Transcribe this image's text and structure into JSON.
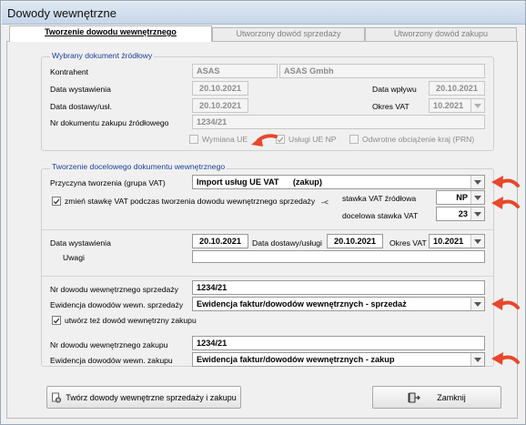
{
  "window": {
    "title": "Dowody wewnętrzne"
  },
  "tabs": [
    {
      "label": "Tworzenie  dowodu wewnętrznego"
    },
    {
      "label": "Utworzony dowód sprzedaży"
    },
    {
      "label": "Utworzony dowód zakupu"
    }
  ],
  "source_doc": {
    "legend": "Wybrany dokument źródłowy",
    "contractor_label": "Kontrahent",
    "contractor_code": "ASAS",
    "contractor_name": "ASAS Gmbh",
    "issue_date_label": "Data wystawienia",
    "issue_date": "20.10.2021",
    "receipt_date_label": "Data wpływu",
    "receipt_date": "20.10.2021",
    "delivery_date_label": "Data dostawy/usł.",
    "delivery_date": "20.10.2021",
    "vat_period_label": "Okres VAT",
    "vat_period": "10.2021",
    "doc_number_label": "Nr dokumentu  zakupu źródłowego",
    "doc_number": "1234/21",
    "checkboxes": [
      {
        "label": "Wymiana UE",
        "checked": false
      },
      {
        "label": "Usługi UE NP",
        "checked": true
      },
      {
        "label": "Odwrotne obciążenie kraj (PRN)",
        "checked": false
      }
    ]
  },
  "target_doc": {
    "legend": "Tworzenie docelowego dokumentu wewnętrznego",
    "reason_label": "Przyczyna tworzenia (grupa VAT)",
    "reason_value": "Import usług UE VAT      (zakup)",
    "change_vat_label": "zmień stawkę VAT podczas tworzenia dowodu wewnętrznego sprzedaży",
    "change_vat_checked": true,
    "arrow_text": "-<",
    "source_rate_label": "stawka VAT źródłowa",
    "source_rate": "NP",
    "target_rate_label": "docelowa stawka VAT",
    "target_rate": "23",
    "issue_date_label": "Data wystawienia",
    "issue_date": "20.10.2021",
    "delivery_date_label": "Data dostawy/usługi",
    "delivery_date": "20.10.2021",
    "vat_period_label": "Okres VAT",
    "vat_period": "10.2021",
    "notes_label": "Uwagi",
    "notes": "",
    "sale_number_label": "Nr dowodu wewnętrznego sprzedaży",
    "sale_number": "1234/21",
    "sale_register_label": "Ewidencja dowodów wewn. sprzedaży",
    "sale_register": "Ewidencja faktur/dowodów wewnętrznych - sprzedaż",
    "create_purchase_label": "utwórz też dowód wewnętrzny zakupu",
    "create_purchase_checked": true,
    "purchase_number_label": "Nr dowodu wewnętrznego zakupu",
    "purchase_number": "1234/21",
    "purchase_register_label": "Ewidencja dowodów wewn. zakupu",
    "purchase_register": "Ewidencja faktur/dowodów wewnętrznych - zakup"
  },
  "buttons": {
    "create_label": "Twórz dowody wewnętrzne sprzedaży i zakupu",
    "close_label": "Zamknij"
  },
  "icons": {
    "create": "document-gear-icon",
    "close": "exit-door-icon",
    "callout": "red-arrow-icon"
  },
  "colors": {
    "legend_text": "#1a3f9a",
    "callout_arrow": "#e8472c",
    "disabled_text": "#8c8c8c"
  }
}
